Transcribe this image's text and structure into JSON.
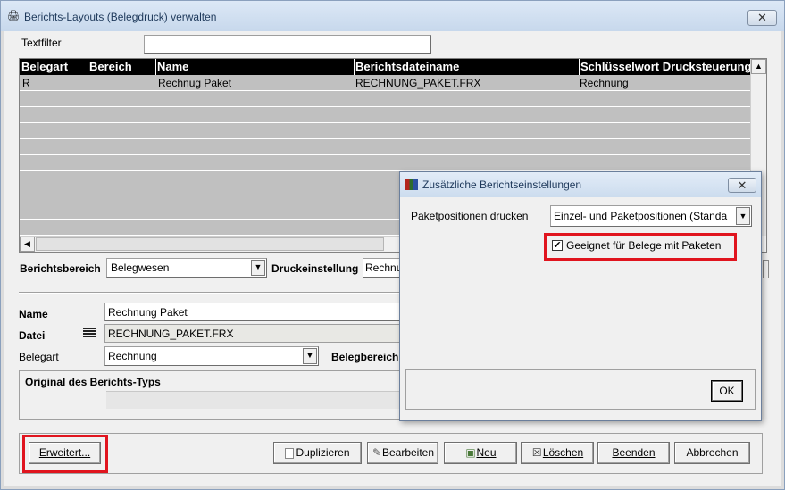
{
  "window": {
    "title": "Berichts-Layouts (Belegdruck) verwalten"
  },
  "filter": {
    "label": "Textfilter",
    "value": ""
  },
  "grid": {
    "columns": [
      "Belegart",
      "Bereich",
      "Name",
      "Berichtsdateiname",
      "Schlüsselwort Drucksteuerung"
    ],
    "rows": [
      {
        "belegart": "R",
        "bereich": "",
        "name": "Rechnug Paket",
        "datei": "RECHNUNG_PAKET.FRX",
        "schluessel": "Rechnung"
      }
    ]
  },
  "form": {
    "berichtsbereich_label": "Berichtsbereich",
    "berichtsbereich_value": "Belegwesen",
    "druckeinstellung_label": "Druckeinstellung",
    "druckeinstellung_value": "Rechnu",
    "name_label": "Name",
    "name_value": "Rechnung Paket",
    "datei_label": "Datei",
    "datei_value": "RECHNUNG_PAKET.FRX",
    "belegart_label": "Belegart",
    "belegart_value": "Rechnung",
    "belegbereich_label": "Belegbereich",
    "original_label": "Original des Berichts-Typs"
  },
  "buttons": {
    "erweitert": "Erweitert...",
    "duplizieren": "Duplizieren",
    "bearbeiten": "Bearbeiten",
    "neu": "Neu",
    "loeschen": "Löschen",
    "beenden": "Beenden",
    "abbrechen": "Abbrechen"
  },
  "dialog": {
    "title": "Zusätzliche Berichtseinstellungen",
    "paketpositionen_label": "Paketpositionen drucken",
    "paketpositionen_value": "Einzel- und Paketpositionen (Standa",
    "checkbox_label": "Geeignet für Belege mit Paketen",
    "checkbox_checked": true,
    "ok_label": "OK"
  },
  "colors": {
    "highlight": "#e0141e",
    "grid_header": "#000000",
    "grid_row": "#c0c0c0"
  }
}
